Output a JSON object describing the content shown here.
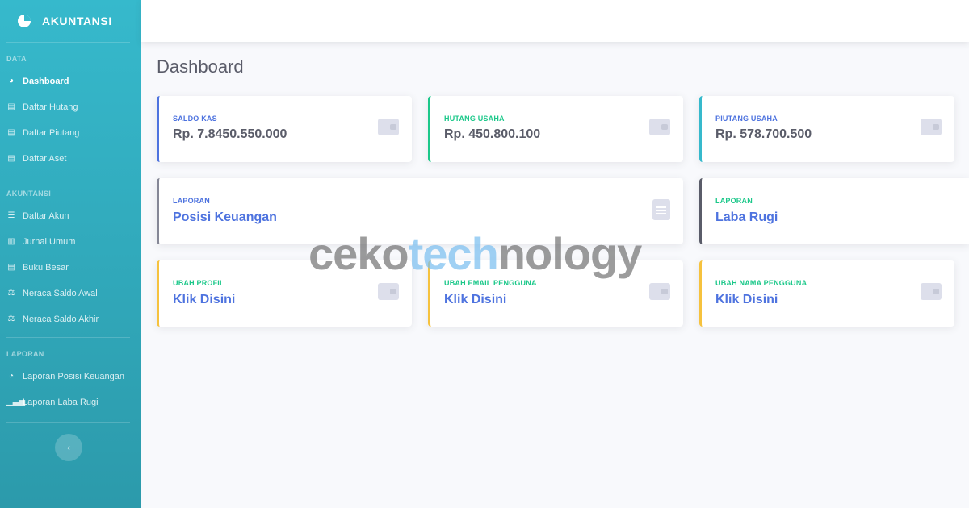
{
  "brand": {
    "name": "AKUNTANSI"
  },
  "sidebar": {
    "sections": [
      {
        "heading": "DATA",
        "items": [
          {
            "label": "Dashboard",
            "icon": "gauge-icon",
            "active": true
          },
          {
            "label": "Daftar Hutang",
            "icon": "book-icon"
          },
          {
            "label": "Daftar Piutang",
            "icon": "book-icon"
          },
          {
            "label": "Daftar Aset",
            "icon": "book-icon"
          }
        ]
      },
      {
        "heading": "AKUNTANSI",
        "items": [
          {
            "label": "Daftar Akun",
            "icon": "list-icon"
          },
          {
            "label": "Jurnal Umum",
            "icon": "books-icon"
          },
          {
            "label": "Buku Besar",
            "icon": "book-icon"
          },
          {
            "label": "Neraca Saldo Awal",
            "icon": "balance-scale-icon"
          },
          {
            "label": "Neraca Saldo Akhir",
            "icon": "balance-scale-icon"
          }
        ]
      },
      {
        "heading": "LAPORAN",
        "items": [
          {
            "label": "Laporan Posisi Keuangan",
            "icon": "pie-chart-icon"
          },
          {
            "label": "Laporan Laba Rugi",
            "icon": "bar-chart-icon"
          }
        ]
      }
    ],
    "toggle_glyph": "‹"
  },
  "main": {
    "title": "Dashboard",
    "cards": {
      "saldo_kas": {
        "label": "SALDO KAS",
        "value": "Rp. 7.8450.550.000",
        "accent": "#4e73df"
      },
      "hutang_usaha": {
        "label": "HUTANG USAHA",
        "value": "Rp. 450.800.100",
        "accent": "#1cc88a"
      },
      "piutang_usaha": {
        "label": "PIUTANG USAHA",
        "value": "Rp. 578.700.500",
        "accent": "#36b9cc"
      },
      "laporan_posisi": {
        "label": "LAPORAN",
        "link": "Posisi Keuangan",
        "accent": "#858796"
      },
      "laporan_laba": {
        "label": "LAPORAN",
        "link": "Laba Rugi",
        "accent": "#5a5c69"
      },
      "ubah_profil": {
        "label": "UBAH PROFIL",
        "link": "Klik Disini",
        "accent": "#f6c23e"
      },
      "ubah_email": {
        "label": "UBAH EMAIL PENGGUNA",
        "link": "Klik Disini",
        "accent": "#f6c23e"
      },
      "ubah_nama": {
        "label": "UBAH NAMA PENGGUNA",
        "link": "Klik Disini",
        "accent": "#f6c23e"
      }
    }
  },
  "watermark": {
    "part1": "ceko",
    "part2": "tech",
    "part3": "nology"
  },
  "colors": {
    "primary": "#4e73df",
    "success": "#1cc88a",
    "info": "#36b9cc",
    "warning": "#f6c23e",
    "secondary": "#858796",
    "dark": "#5a5c69"
  }
}
